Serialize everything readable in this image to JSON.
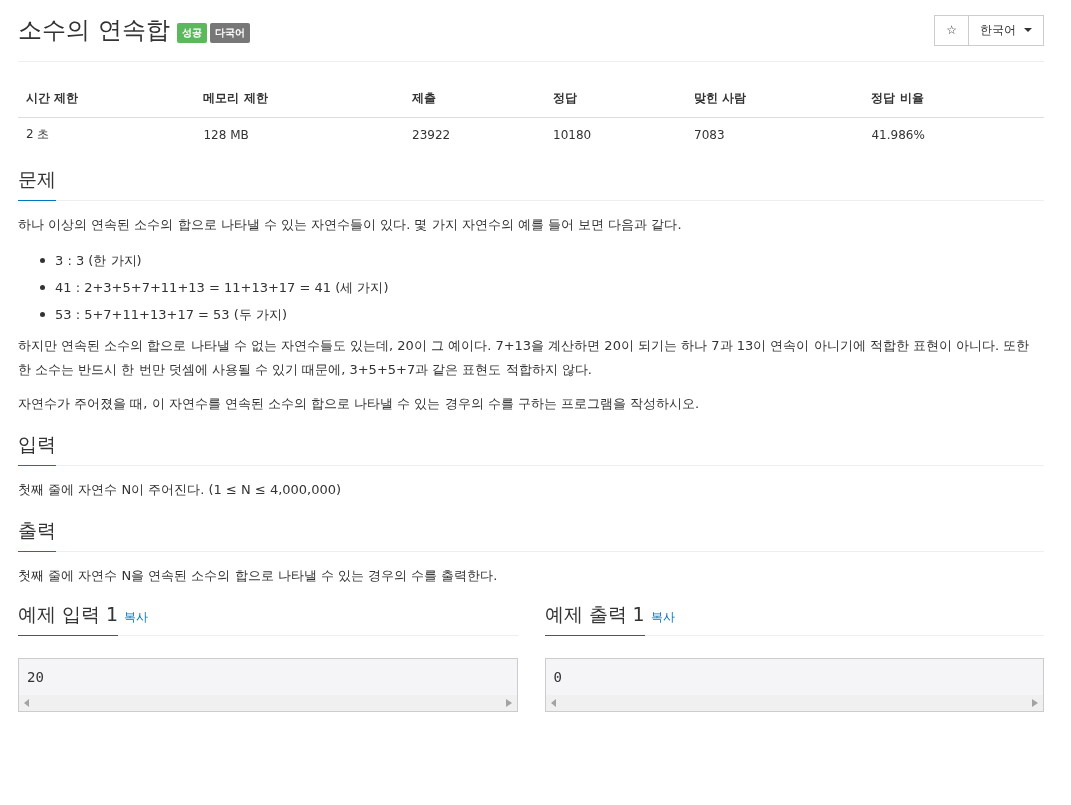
{
  "title": "소수의 연속합",
  "badges": [
    {
      "label": "성공",
      "color": "#5cb85c"
    },
    {
      "label": "다국어",
      "color": "#777777"
    }
  ],
  "star_button": {
    "label": "☆"
  },
  "language_dropdown": {
    "value": "한국어"
  },
  "info_table": {
    "columns": [
      "시간 제한",
      "메모리 제한",
      "제출",
      "정답",
      "맞힌 사람",
      "정답 비율"
    ],
    "rows": [
      [
        "2 초",
        "128 MB",
        "23922",
        "10180",
        "7083",
        "41.986%"
      ]
    ]
  },
  "sections": [
    {
      "heading": "문제",
      "paragraphs": [
        "하나 이상의 연속된 소수의 합으로 나타낼 수 있는 자연수들이 있다. 몇 가지 자연수의 예를 들어 보면 다음과 같다."
      ],
      "bullets": [
        "3 : 3 (한 가지)",
        "41 : 2+3+5+7+11+13 = 11+13+17 = 41 (세 가지)",
        "53 : 5+7+11+13+17 = 53 (두 가지)"
      ],
      "paragraphs_after": [
        "하지만 연속된 소수의 합으로 나타낼 수 없는 자연수들도 있는데, 20이 그 예이다. 7+13을 계산하면 20이 되기는 하나 7과 13이 연속이 아니기에 적합한 표현이 아니다. 또한 한 소수는 반드시 한 번만 덧셈에 사용될 수 있기 때문에, 3+5+5+7과 같은 표현도 적합하지 않다.",
        "자연수가 주어졌을 때, 이 자연수를 연속된 소수의 합으로 나타낼 수 있는 경우의 수를 구하는 프로그램을 작성하시오."
      ]
    },
    {
      "heading": "입력",
      "paragraphs": [
        "첫째 줄에 자연수 N이 주어진다. (1 ≤ N ≤ 4,000,000)"
      ]
    },
    {
      "heading": "출력",
      "paragraphs": [
        "첫째 줄에 자연수 N을 연속된 소수의 합으로 나타낼 수 있는 경우의 수를 출력한다."
      ]
    }
  ],
  "samples": [
    {
      "heading": "예제 입력 1",
      "copy_link": "복사",
      "content": "20"
    },
    {
      "heading": "예제 출력 1",
      "copy_link": "복사",
      "content": "0"
    }
  ]
}
